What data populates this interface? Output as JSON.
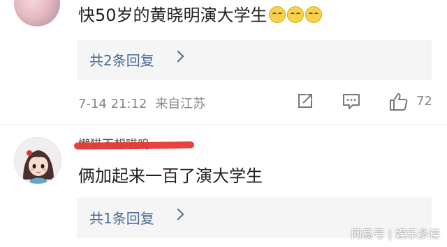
{
  "comments": [
    {
      "text": "快50岁的黄晓明演大学生",
      "reply_label": "共2条回复",
      "time": "7-14 21:12",
      "location": "来自江苏",
      "likes": "72"
    },
    {
      "username": "懒猫不想喵呜",
      "text": "俩加起来一百了演大学生",
      "reply_label": "共1条回复"
    }
  ],
  "icons": {
    "share": "share-icon",
    "comment": "comment-icon",
    "like": "thumbs-up-icon",
    "chevron": "chevron-right-icon"
  },
  "colors": {
    "reply_text": "#4a6c95",
    "reply_bg": "#f5f5f5",
    "meta_text": "#888888",
    "redaction": "#e53935"
  },
  "watermark": "网易号 | 娱乐多谍"
}
